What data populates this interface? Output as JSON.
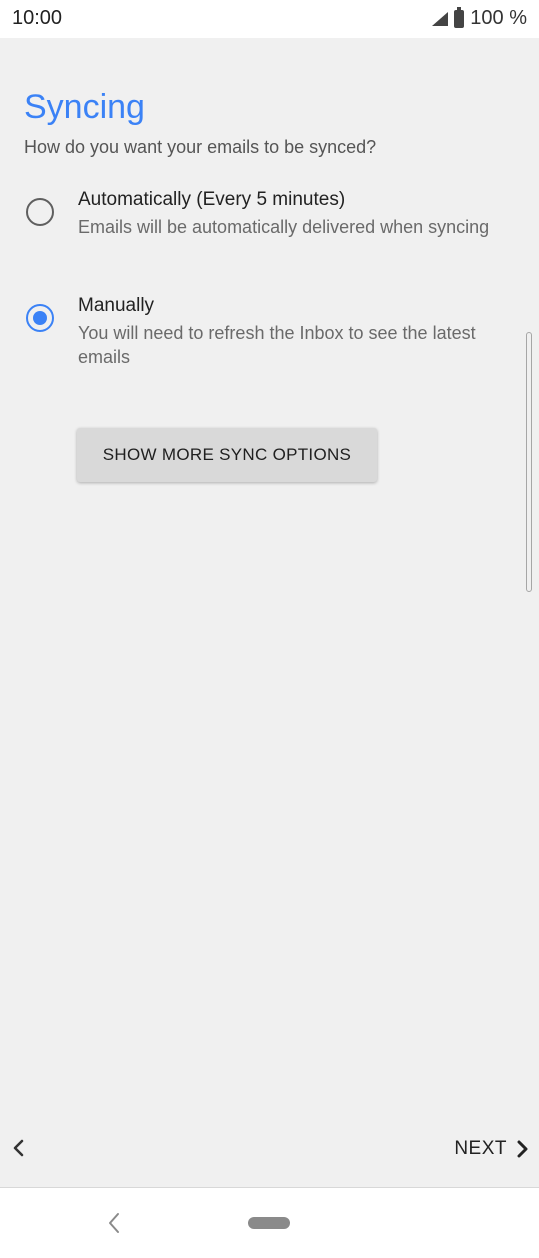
{
  "status_bar": {
    "time": "10:00",
    "battery": "100 %",
    "icons": [
      "signal-icon",
      "battery-icon"
    ]
  },
  "page": {
    "title": "Syncing",
    "subtitle": "How do you want your emails to be synced?"
  },
  "sync_options": [
    {
      "label": "Automatically (Every 5 minutes)",
      "description": "Emails will be automatically delivered when syncing",
      "selected": false
    },
    {
      "label": "Manually",
      "description": "You will need to refresh the Inbox to see the latest emails",
      "selected": true
    }
  ],
  "more_options_button": "SHOW MORE SYNC OPTIONS",
  "footer": {
    "back_icon": "chevron-left-icon",
    "next_label": "NEXT",
    "next_icon": "chevron-right-icon"
  },
  "colors": {
    "accent": "#3b82f6",
    "background": "#f0f0f0"
  }
}
